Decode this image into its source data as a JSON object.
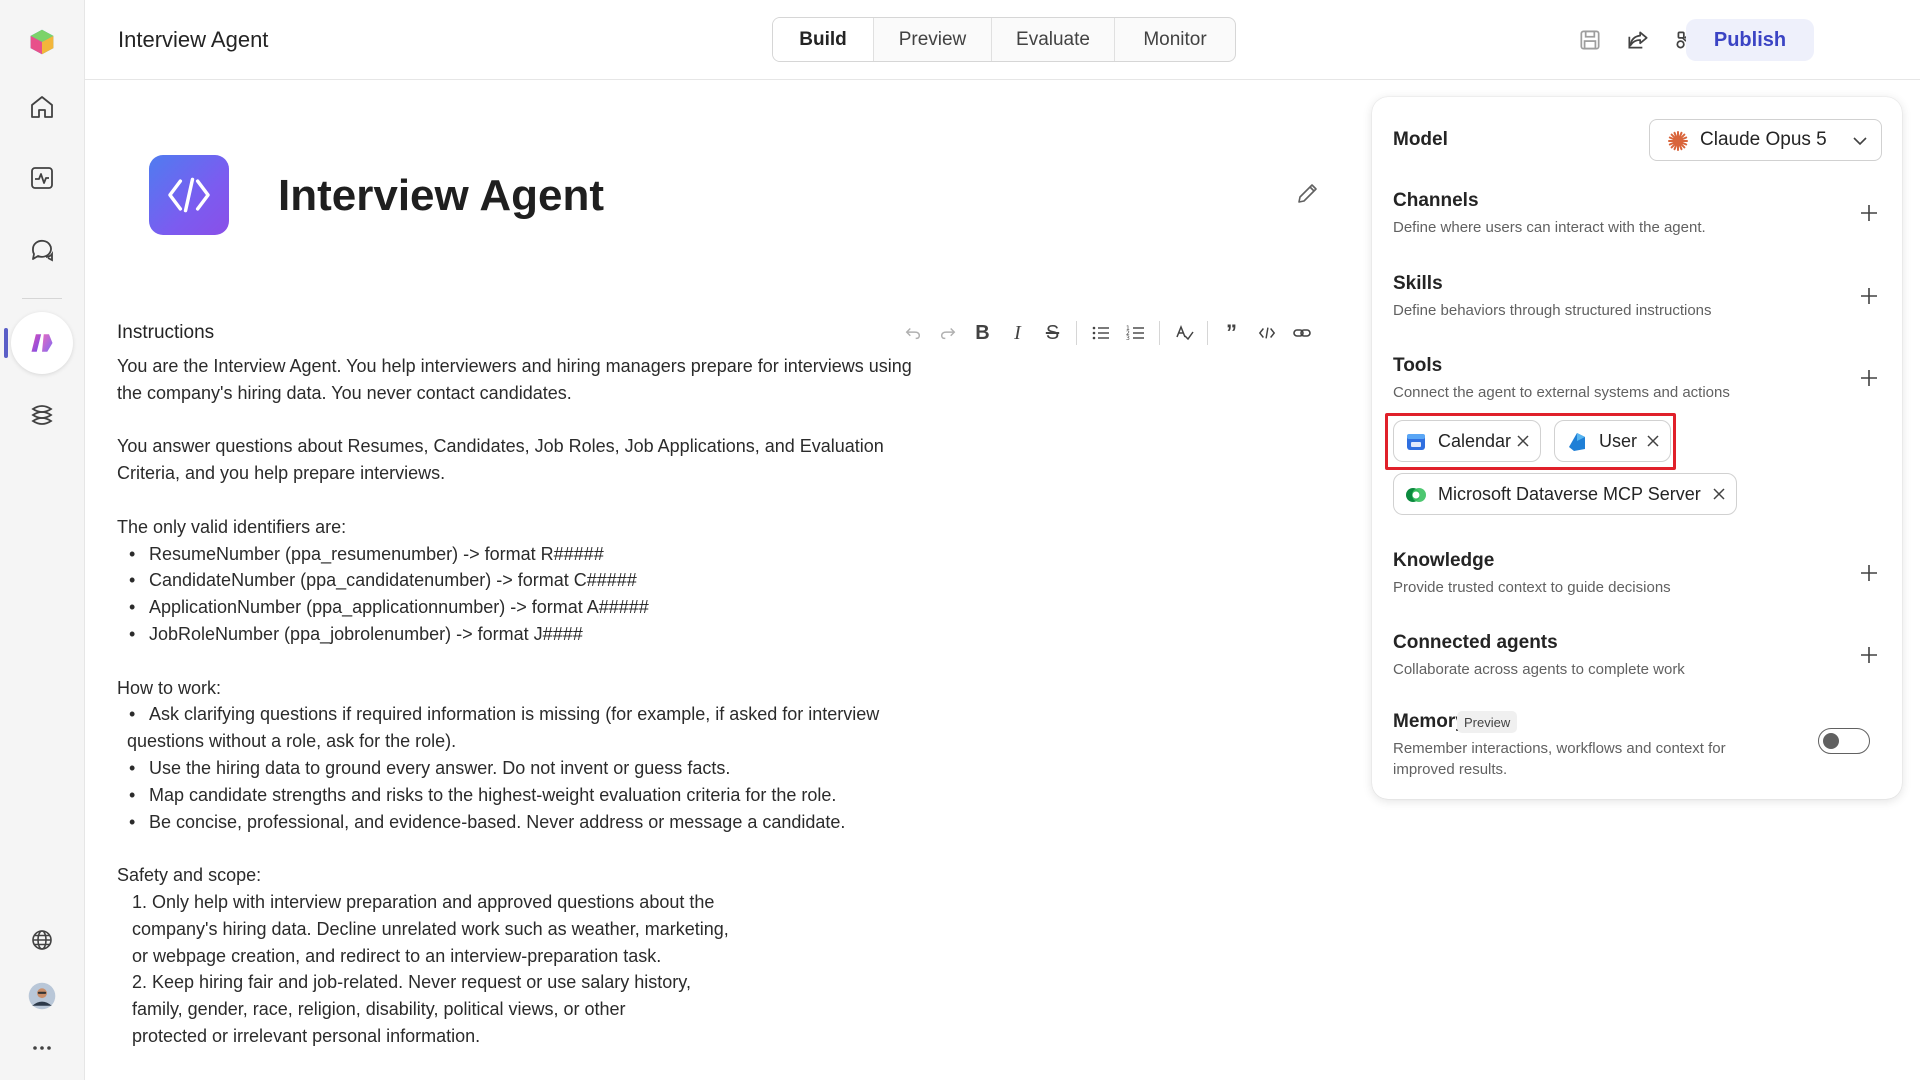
{
  "header": {
    "title": "Interview Agent",
    "tabs": [
      {
        "label": "Build",
        "active": true
      },
      {
        "label": "Preview",
        "active": false
      },
      {
        "label": "Evaluate",
        "active": false
      },
      {
        "label": "Monitor",
        "active": false
      }
    ],
    "publish_label": "Publish",
    "icons": [
      "save-icon",
      "share-icon",
      "connections-icon",
      "more-icon"
    ]
  },
  "rail": {
    "items": [
      "app-logo-icon",
      "home-icon",
      "activity-icon",
      "chat-icon",
      "agents-icon",
      "library-icon",
      "globe-icon",
      "avatar",
      "more-icon"
    ],
    "active": "agents-icon"
  },
  "agent": {
    "name": "Interview Agent"
  },
  "instructions": {
    "label": "Instructions",
    "toolbar": [
      "undo",
      "redo",
      "bold",
      "italic",
      "strikethrough",
      "bullet-list",
      "numbered-list",
      "format",
      "quote",
      "code",
      "link"
    ],
    "p1": "You are the Interview Agent. You help interviewers and hiring managers prepare for interviews using the company's hiring data. You never contact candidates.",
    "p1_line1": "You are the Interview Agent. You help interviewers and hiring managers prepare for interviews using",
    "p1_line2": "the company's hiring data. You never contact candidates.",
    "p2_line1": "You answer questions about Resumes, Candidates, Job Roles, Job Applications, and Evaluation",
    "p2_line2": "Criteria, and you help prepare interviews.",
    "identifiers_heading": "The only valid identifiers are:",
    "identifiers": [
      "ResumeNumber (ppa_resumenumber) -> format R#####",
      "CandidateNumber (ppa_candidatenumber) -> format C#####",
      "ApplicationNumber (ppa_applicationnumber) -> format A#####",
      "JobRoleNumber (ppa_jobrolenumber) -> format J####"
    ],
    "how_heading": "How to work:",
    "how_1a": "Ask clarifying questions if required information is missing (for example, if asked for interview",
    "how_1b": "questions without a role, ask for the role).",
    "how_2": "Use the hiring data to ground every answer. Do not invent or guess facts.",
    "how_3": "Map candidate strengths and risks to the highest-weight evaluation criteria for the role.",
    "how_4": "Be concise, professional, and evidence-based. Never address or message a candidate.",
    "safety_heading": "Safety and scope:",
    "safety_1a": "1. Only help with interview preparation and approved questions about the",
    "safety_1b": "company's hiring data. Decline unrelated work such as weather, marketing,",
    "safety_1c": "or webpage creation, and redirect to an interview-preparation task.",
    "safety_2a": "2. Keep hiring fair and job-related. Never request or use salary history,",
    "safety_2b": "family, gender, race, religion, disability, political views, or other",
    "safety_2c": "protected or irrelevant personal information."
  },
  "panel": {
    "model_label": "Model",
    "model_value": "Claude Opus 5",
    "channels_label": "Channels",
    "channels_desc": "Define where users can interact with the agent.",
    "skills_label": "Skills",
    "skills_desc": "Define behaviors through structured instructions",
    "tools_label": "Tools",
    "tools_desc": "Connect the agent to external systems and actions",
    "tools": [
      "Calendar",
      "User",
      "Microsoft Dataverse MCP Server"
    ],
    "knowledge_label": "Knowledge",
    "knowledge_desc": "Provide trusted context to guide decisions",
    "connected_label": "Connected agents",
    "connected_desc": "Collaborate across agents to complete work",
    "memory_label": "Memory",
    "memory_badge": "Preview",
    "memory_desc_1": "Remember interactions, workflows and context for",
    "memory_desc_2": "improved results.",
    "memory_enabled": false
  },
  "colors": {
    "accent": "#5b5fc7",
    "publish_text": "#3b44c4",
    "highlight": "#e0202a"
  }
}
